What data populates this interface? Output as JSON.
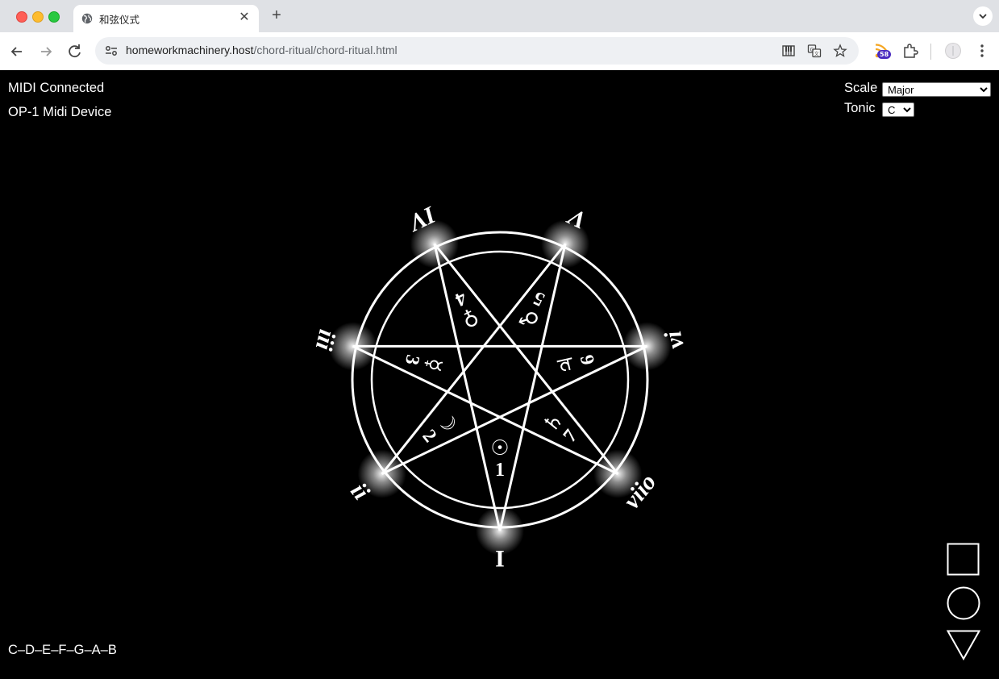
{
  "browser": {
    "tab_title": "和弦仪式",
    "url_host": "homeworkmachinery.host",
    "url_path": "/chord-ritual/chord-ritual.html",
    "extension_badge": "58"
  },
  "midi": {
    "status": "MIDI Connected",
    "device": "OP-1 Midi Device"
  },
  "controls": {
    "scale_label": "Scale",
    "scale_value": "Major",
    "tonic_label": "Tonic",
    "tonic_value": "C"
  },
  "sigil": {
    "degrees": [
      {
        "roman": "I",
        "number": "1",
        "planet": "☉"
      },
      {
        "roman": "ii",
        "number": "2",
        "planet": "☽"
      },
      {
        "roman": "iii",
        "number": "3",
        "planet": "☿"
      },
      {
        "roman": "IV",
        "number": "4",
        "planet": "♀"
      },
      {
        "roman": "V",
        "number": "5",
        "planet": "♂"
      },
      {
        "roman": "vi",
        "number": "6",
        "planet": "♃"
      },
      {
        "roman": "viio",
        "number": "7",
        "planet": "♄"
      }
    ]
  },
  "scale_notes": "C–D–E–F–G–A–B",
  "shape_buttons": [
    "square",
    "circle",
    "triangle"
  ]
}
